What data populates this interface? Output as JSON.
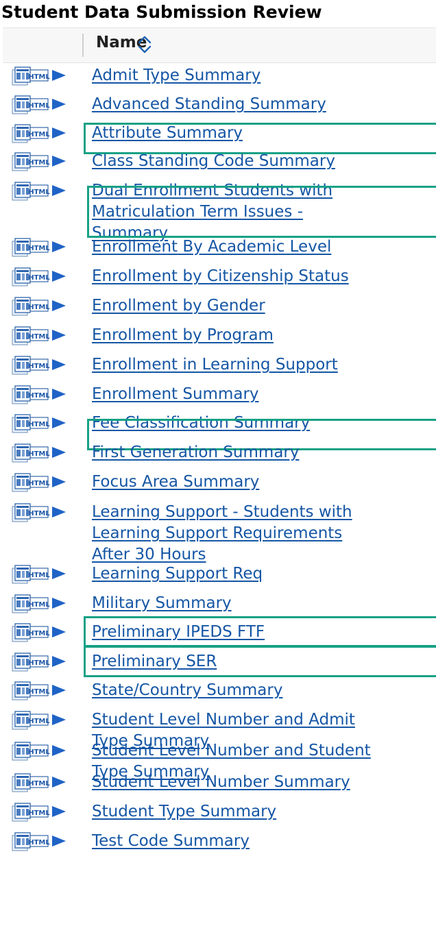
{
  "page": {
    "title": "Student Data Submission Review",
    "column_header": "Name",
    "sort_icon": "sort-up-down-icon",
    "row_icon": "html-report-icon",
    "highlight_color": "#17a186",
    "link_color": "#1556a5"
  },
  "reports": [
    {
      "lines": [
        "Admit Type Summary"
      ],
      "highlighted": false
    },
    {
      "lines": [
        "Advanced Standing Summary"
      ],
      "highlighted": false
    },
    {
      "lines": [
        "Attribute Summary"
      ],
      "highlighted": true
    },
    {
      "lines": [
        "Class Standing Code Summary"
      ],
      "highlighted": false
    },
    {
      "lines": [
        "Dual Enrollment Students with",
        "Matriculation Term Issues -",
        "Summary"
      ],
      "highlighted": true
    },
    {
      "lines": [
        "Enrollment By Academic Level"
      ],
      "highlighted": false
    },
    {
      "lines": [
        "Enrollment by Citizenship Status"
      ],
      "highlighted": false
    },
    {
      "lines": [
        "Enrollment by Gender"
      ],
      "highlighted": false
    },
    {
      "lines": [
        "Enrollment by Program"
      ],
      "highlighted": false
    },
    {
      "lines": [
        "Enrollment in Learning Support"
      ],
      "highlighted": false
    },
    {
      "lines": [
        "Enrollment Summary"
      ],
      "highlighted": false
    },
    {
      "lines": [
        "Fee Classification Summary"
      ],
      "highlighted": true
    },
    {
      "lines": [
        "First Generation Summary"
      ],
      "highlighted": false
    },
    {
      "lines": [
        "Focus Area Summary"
      ],
      "highlighted": false
    },
    {
      "lines": [
        "Learning Support - Students with",
        "Learning Support Requirements",
        "After 30 Hours"
      ],
      "highlighted": false
    },
    {
      "lines": [
        "Learning Support Req"
      ],
      "highlighted": false
    },
    {
      "lines": [
        "Military Summary"
      ],
      "highlighted": false
    },
    {
      "lines": [
        "Preliminary IPEDS FTF"
      ],
      "highlighted": true
    },
    {
      "lines": [
        "Preliminary SER"
      ],
      "highlighted": true
    },
    {
      "lines": [
        "State/Country Summary"
      ],
      "highlighted": false
    },
    {
      "lines": [
        "Student Level Number and Admit",
        "Type Summary"
      ],
      "highlighted": false
    },
    {
      "lines": [
        "Student Level Number and Student",
        "Type Summary"
      ],
      "highlighted": false
    },
    {
      "lines": [
        "Student Level Number Summary"
      ],
      "highlighted": false
    },
    {
      "lines": [
        "Student Type Summary"
      ],
      "highlighted": false
    },
    {
      "lines": [
        "Test Code Summary"
      ],
      "highlighted": false
    }
  ]
}
